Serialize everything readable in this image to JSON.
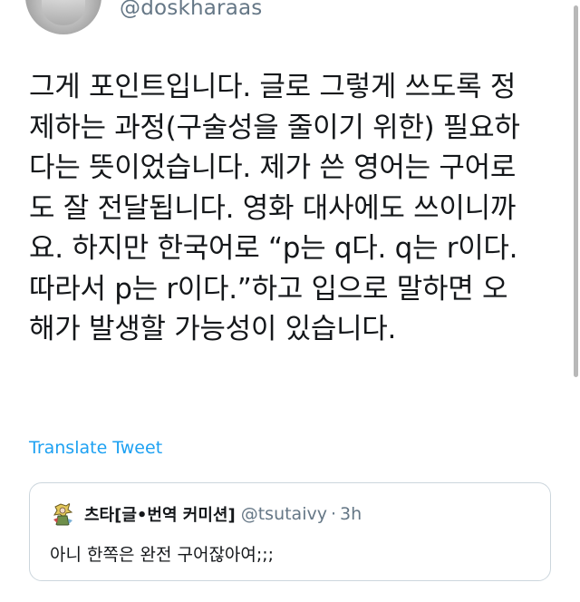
{
  "author": {
    "handle": "@doskharaas"
  },
  "tweet": {
    "text": "그게 포인트입니다. 글로 그렇게 쓰도록 정\n제하는 과정(구술성을 줄이기 위한) 필요하\n다는 뜻이었습니다. 제가 쓴 영어는 구어로\n도 잘 전달됩니다. 영화 대사에도 쓰이니까\n요. 하지만 한국어로 “p는 q다. q는 r이다.\n따라서 p는 r이다.”하고 입으로 말하면 오\n해가 발생할 가능성이 있습니다.",
    "translate_label": "Translate Tweet"
  },
  "quoted_tweet": {
    "name": "츠타[글•번역 커미션]",
    "handle": "@tsutaivy",
    "separator": "·",
    "time": "3h",
    "text": "아니 한쪽은 완전 구어잖아여;;;"
  },
  "colors": {
    "link": "#1da1f2",
    "secondary_text": "#657786",
    "primary_text": "#14171a",
    "border": "#ccd6dd"
  }
}
